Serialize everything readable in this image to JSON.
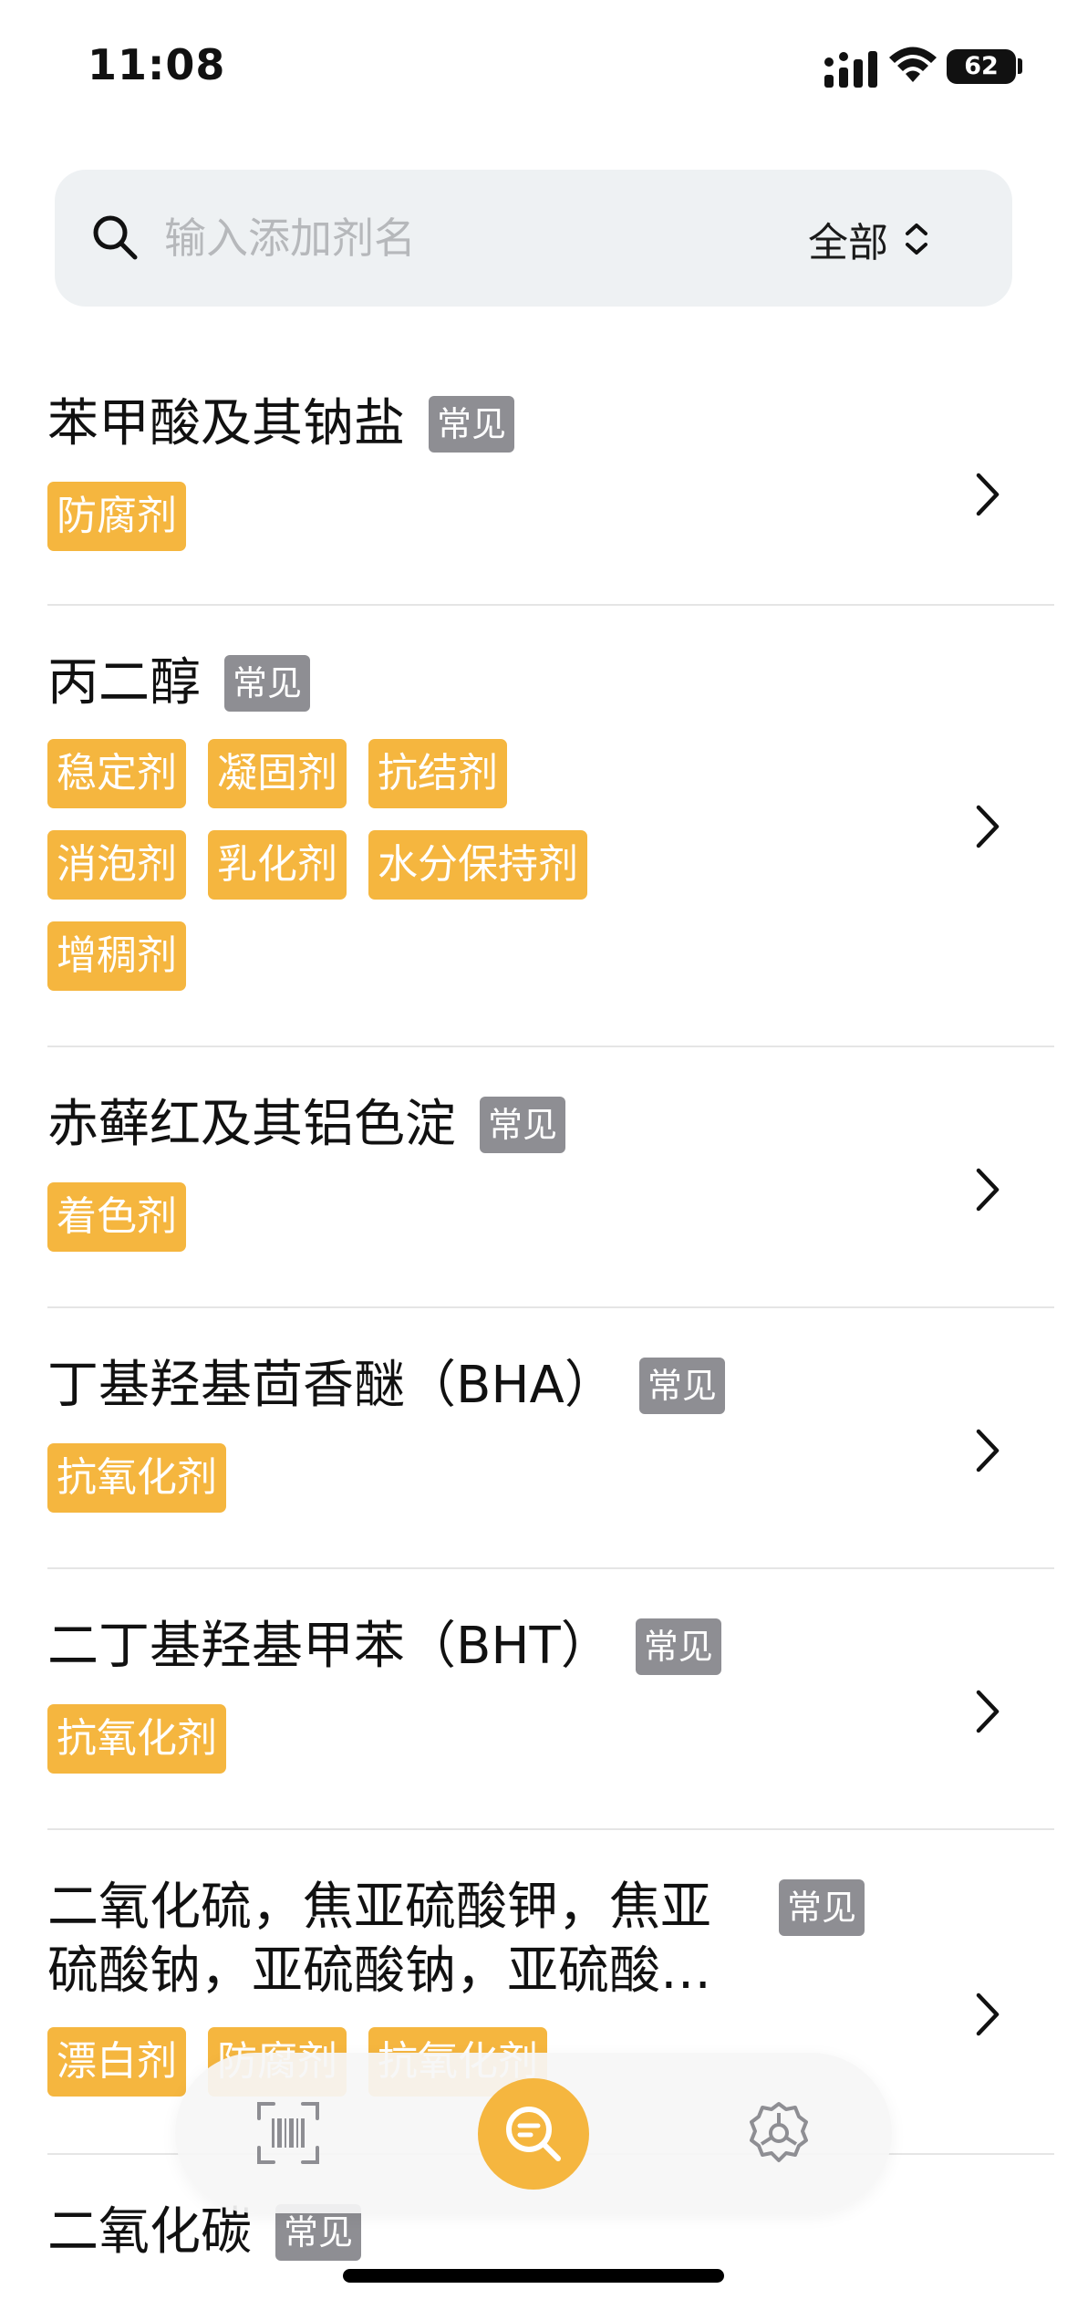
{
  "status_bar": {
    "time": "11:08",
    "battery": "62"
  },
  "search": {
    "placeholder": "输入添加剂名",
    "value": "",
    "filter_label": "全部"
  },
  "items": [
    {
      "name": "苯甲酸及其钠盐",
      "badge": "常见",
      "tags": [
        "防腐剂"
      ]
    },
    {
      "name": "丙二醇",
      "badge": "常见",
      "tags": [
        "稳定剂",
        "凝固剂",
        "抗结剂",
        "消泡剂",
        "乳化剂",
        "水分保持剂",
        "增稠剂"
      ]
    },
    {
      "name": "赤藓红及其铝色淀",
      "badge": "常见",
      "tags": [
        "着色剂"
      ]
    },
    {
      "name": "丁基羟基茴香醚（BHA）",
      "badge": "常见",
      "tags": [
        "抗氧化剂"
      ]
    },
    {
      "name": "二丁基羟基甲苯（BHT）",
      "badge": "常见",
      "tags": [
        "抗氧化剂"
      ]
    },
    {
      "name_line1": "二氧化硫，焦亚硫酸钾，焦亚",
      "name_line2": "硫酸钠，亚硫酸钠，亚硫酸…",
      "badge": "常见",
      "tags": [
        "漂白剂",
        "防腐剂",
        "抗氧化剂"
      ]
    },
    {
      "name": "二氧化碳",
      "badge": "常见"
    }
  ],
  "toolbar": {
    "icons": [
      "barcode-scan-icon",
      "search-list-icon",
      "settings-icon"
    ],
    "accent": "#f5b63f"
  },
  "colors": {
    "tag": "#f5b63f",
    "badge": "#8e8e93",
    "search_bg": "#eef1f3"
  }
}
